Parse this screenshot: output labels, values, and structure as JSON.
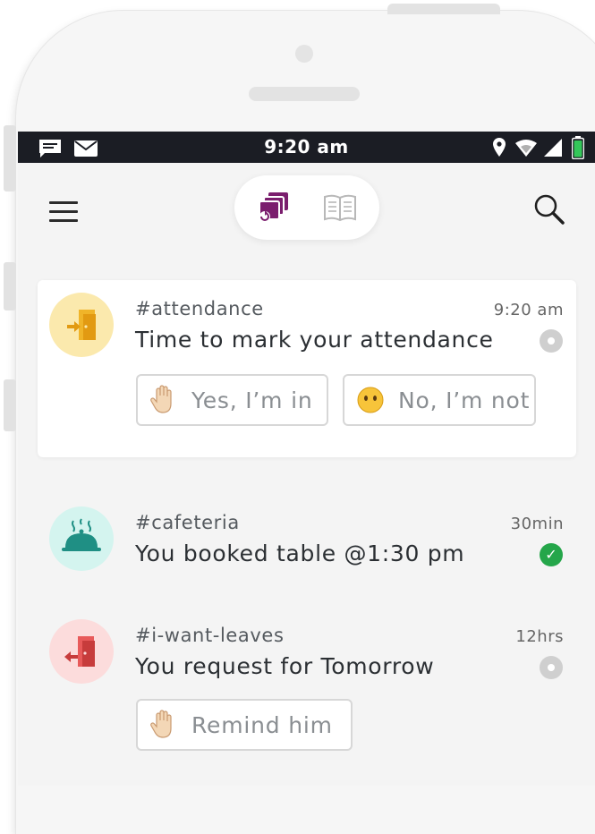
{
  "statusbar": {
    "time": "9:20 am",
    "left_icons": [
      "message-icon",
      "mail-icon"
    ],
    "right_icons": [
      "location-icon",
      "wifi-icon",
      "signal-icon",
      "battery-icon"
    ],
    "battery_color": "#34c759"
  },
  "header": {
    "tabs": [
      {
        "icon": "feed-stack-icon",
        "active": true,
        "color": "#7b1e6e"
      },
      {
        "icon": "book-icon",
        "active": false,
        "color": "#b8b8b8"
      }
    ]
  },
  "feed": [
    {
      "channel": "#attendance",
      "message": "Time to mark your attendance",
      "time": "9:20 am",
      "status": "pending",
      "avatar_icon": "door-enter-icon",
      "avatar_bg": "#fbe9ad",
      "actions": [
        {
          "emoji": "raised-hand-icon",
          "label": "Yes, I’m in"
        },
        {
          "emoji": "no-mouth-face-icon",
          "label": "No, I’m not"
        }
      ]
    },
    {
      "channel": "#cafeteria",
      "message": "You booked table @1:30 pm",
      "time": "30min",
      "status": "done",
      "avatar_icon": "cloche-icon",
      "avatar_bg": "#d4f4ef"
    },
    {
      "channel": "#i-want-leaves",
      "message": "You request for Tomorrow",
      "time": "12hrs",
      "status": "pending",
      "avatar_icon": "door-exit-icon",
      "avatar_bg": "#fcdcdc",
      "actions": [
        {
          "emoji": "raised-hand-icon",
          "label": "Remind him"
        }
      ]
    }
  ]
}
